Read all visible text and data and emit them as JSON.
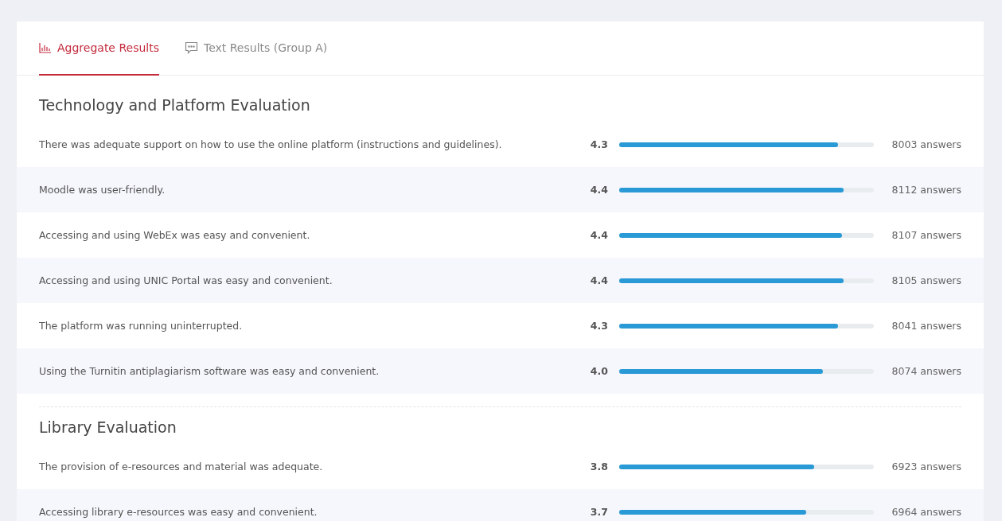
{
  "tabs": [
    {
      "label": "Aggregate Results",
      "kind": "chart",
      "selected": true
    },
    {
      "label": "Text Results (Group A)",
      "kind": "comment",
      "selected": false
    }
  ],
  "sections": [
    {
      "title": "Technology and Platform Evaluation",
      "questions": [
        {
          "text": "There was adequate support on how to use the online platform (instructions and guidelines).",
          "score": "4.3",
          "level": 0.86,
          "answers": "8003 answers"
        },
        {
          "text": "Moodle was user-friendly.",
          "score": "4.4",
          "level": 0.88,
          "answers": "8112 answers"
        },
        {
          "text": "Accessing and using WebEx was easy and convenient.",
          "score": "4.4",
          "level": 0.875,
          "answers": "8107 answers"
        },
        {
          "text": "Accessing and using UNIC Portal was easy and convenient.",
          "score": "4.4",
          "level": 0.88,
          "answers": "8105 answers"
        },
        {
          "text": "The platform was running uninterrupted.",
          "score": "4.3",
          "level": 0.86,
          "answers": "8041 answers"
        },
        {
          "text": "Using the Turnitin antiplagiarism software was easy and convenient.",
          "score": "4.0",
          "level": 0.8,
          "answers": "8074 answers"
        }
      ]
    },
    {
      "title": "Library Evaluation",
      "questions": [
        {
          "text": "The provision of e-resources and material was adequate.",
          "score": "3.8",
          "level": 0.765,
          "answers": "6923 answers"
        },
        {
          "text": "Accessing library e-resources was easy and convenient.",
          "score": "3.7",
          "level": 0.735,
          "answers": "6964 answers"
        }
      ]
    }
  ]
}
